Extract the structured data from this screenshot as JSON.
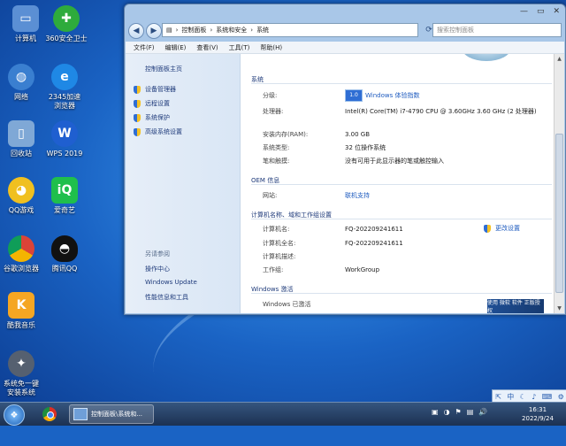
{
  "desktop": {
    "icons": [
      {
        "label": "计算机",
        "icon": "computer-icon",
        "color": "#5b8fd4",
        "glyph": "▭"
      },
      {
        "label": "360安全卫士",
        "icon": "shield-plus-icon",
        "color": "#2eab3c",
        "glyph": "✚"
      },
      {
        "label": "网络",
        "icon": "network-icon",
        "color": "#3a7fd0",
        "glyph": "◍"
      },
      {
        "label": "2345加速浏览器",
        "icon": "browser-e-icon",
        "color": "#1f88e5",
        "glyph": "e"
      },
      {
        "label": "回收站",
        "icon": "recycle-bin-icon",
        "color": "#7fa8d6",
        "glyph": "▯"
      },
      {
        "label": "WPS 2019",
        "icon": "wps-icon",
        "color": "#1f5fd0",
        "glyph": "W"
      },
      {
        "label": "QQ游戏",
        "icon": "qq-game-icon",
        "color": "#f0c020",
        "glyph": "◕"
      },
      {
        "label": "爱奇艺",
        "icon": "iqiyi-icon",
        "color": "#1fbf4c",
        "glyph": "iQ"
      },
      {
        "label": "谷歌浏览器",
        "icon": "chrome-icon",
        "color": "#db4437",
        "glyph": "◉"
      },
      {
        "label": "腾讯QQ",
        "icon": "qq-penguin-icon",
        "color": "#111111",
        "glyph": "◓"
      },
      {
        "label": "酷我音乐",
        "icon": "kuwo-music-icon",
        "color": "#f5a623",
        "glyph": "K"
      },
      {
        "label": "系统免一键安装系统",
        "icon": "rabbit-icon",
        "color": "#556070",
        "glyph": "✦"
      }
    ]
  },
  "window": {
    "address": [
      "控制面板",
      "系统和安全",
      "系统"
    ],
    "search_placeholder": "搜索控制面板",
    "menu": [
      "文件(F)",
      "编辑(E)",
      "查看(V)",
      "工具(T)",
      "帮助(H)"
    ],
    "left_pane": {
      "home": "控制面板主页",
      "tasks": [
        "设备管理器",
        "远程设置",
        "系统保护",
        "高级系统设置"
      ],
      "see_also_title": "另请参阅",
      "see_also": [
        "操作中心",
        "Windows Update",
        "性能信息和工具"
      ]
    },
    "system": {
      "title": "系统",
      "rating_label": "分级:",
      "rating_badge": "1.0",
      "rating_value": "Windows 体验指数",
      "cpu_label": "处理器:",
      "cpu_value": "Intel(R) Core(TM) i7-4790 CPU @ 3.60GHz   3.60 GHz  (2 处理器)",
      "ram_label": "安装内存(RAM):",
      "ram_value": "3.00 GB",
      "type_label": "系统类型:",
      "type_value": "32 位操作系统",
      "touch_label": "笔和触摸:",
      "touch_value": "没有可用于此显示器的笔或触控输入"
    },
    "oem": {
      "title": "OEM 信息",
      "site_label": "网站:",
      "site_value": "联机支持"
    },
    "computer": {
      "title": "计算机名称、域和工作组设置",
      "name_label": "计算机名:",
      "name_value": "FQ-202209241611",
      "fullname_label": "计算机全名:",
      "fullname_value": "FQ-202209241611",
      "desc_label": "计算机描述:",
      "desc_value": "",
      "workgroup_label": "工作组:",
      "workgroup_value": "WorkGroup",
      "change_label": "更改设置"
    },
    "activation": {
      "title": "Windows 激活",
      "status": "Windows 已激活",
      "genuine_badge": "使用 微软 软件 正版授权"
    }
  },
  "tray_popup": [
    "⇱",
    "中",
    "☾",
    "♪",
    "⌨",
    "⚙"
  ],
  "taskbar": {
    "active_window_label": "控制面板\\系统和...",
    "tray_icons": [
      "▣",
      "◑",
      "⚑",
      "▤",
      "🔊"
    ],
    "time": "16:31",
    "date": "2022/9/24"
  }
}
